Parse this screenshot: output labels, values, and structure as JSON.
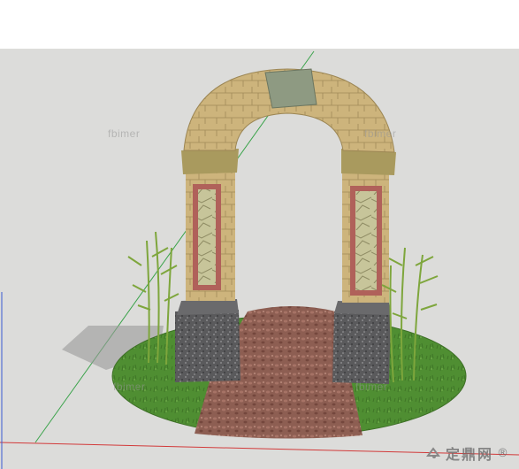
{
  "scene": {
    "subject": "sketchup-garden-arch-model",
    "colors": {
      "top_band": "#ffffff",
      "backdrop": "#dcdcda",
      "grass": "#4f8e32",
      "path": "#8a5a4e",
      "stone_arch": "#cbb27a",
      "granite_base": "#5b5b5d",
      "frame": "#b0615a",
      "bamboo": "#7ea63c",
      "axis_green": "#3aa34a",
      "axis_red": "#d23a3a"
    }
  },
  "watermarks": {
    "wm1": "fbimer",
    "wm2": "fbimer",
    "wm3": "fbimer",
    "wm4": "fbimer"
  },
  "brand": {
    "icon": "brand-logo-icon",
    "text": "定鼎网",
    "suffix": "®"
  }
}
